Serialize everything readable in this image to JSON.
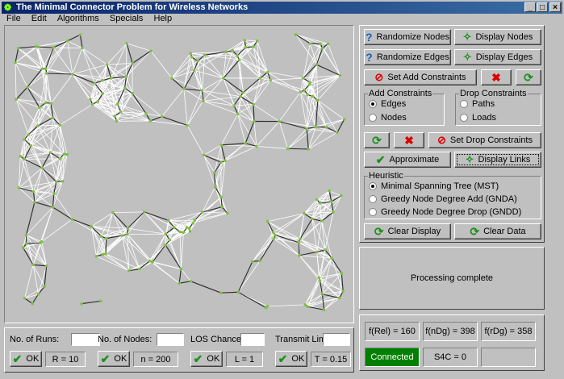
{
  "window": {
    "title": "The Minimal Connector Problem for Wireless Networks"
  },
  "menu": [
    "File",
    "Edit",
    "Algorithms",
    "Specials",
    "Help"
  ],
  "buttons": {
    "randomize_nodes": "Randomize Nodes",
    "display_nodes": "Display Nodes",
    "randomize_edges": "Randomize Edges",
    "display_edges": "Display Edges",
    "set_add_constraints": "Set Add Constraints",
    "set_drop_constraints": "Set Drop Constraints",
    "approximate": "Approximate",
    "display_links": "Display Links",
    "clear_display": "Clear Display",
    "clear_data": "Clear Data"
  },
  "add_constraints": {
    "legend": "Add Constraints",
    "options": [
      "Edges",
      "Nodes"
    ],
    "selected": "Edges"
  },
  "drop_constraints": {
    "legend": "Drop Constraints",
    "options": [
      "Paths",
      "Loads"
    ]
  },
  "heuristic": {
    "legend": "Heuristic",
    "options": [
      "Minimal Spanning Tree (MST)",
      "Greedy Node Degree Add (GNDA)",
      "Greedy Node Degree Drop (GNDD)"
    ],
    "selected": "Minimal Spanning Tree (MST)"
  },
  "message": "Processing complete",
  "metrics": {
    "f_rel": "f(Rel) = 160",
    "f_ndg": "f(nDg) = 398",
    "f_rdg": "f(rDg) = 358",
    "connected": "Connected",
    "s4c": "S4C = 0"
  },
  "inputs": {
    "runs": {
      "label": "No. of Runs:",
      "ok": "OK",
      "value": "R = 10"
    },
    "nodes": {
      "label": "No. of Nodes:",
      "ok": "OK",
      "value": "n = 200"
    },
    "los": {
      "label": "LOS Chance:",
      "ok": "OK",
      "value": "L = 1"
    },
    "transmit": {
      "label": "Transmit Limit:",
      "ok": "OK",
      "value": "T = 0.15"
    }
  },
  "colors": {
    "title_bar": "#0a246a",
    "connected": "#008000",
    "node": "#7fbf3f",
    "edge": "#ffffff",
    "tree_edge": "#303030"
  },
  "icons": {
    "help": "question-icon",
    "display": "running-man-icon",
    "stop": "no-entry-icon",
    "cancel": "red-x-icon",
    "refresh": "green-refresh-icon",
    "ok": "green-check-icon"
  }
}
